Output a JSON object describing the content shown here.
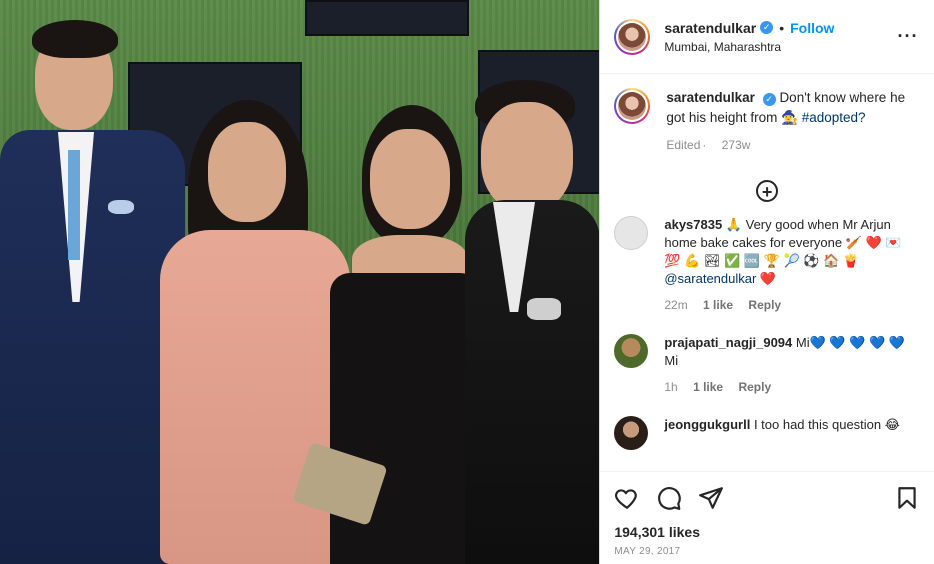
{
  "post": {
    "username": "saratendulkar",
    "follow_label": "Follow",
    "location": "Mumbai, Maharashtra",
    "caption": {
      "text": "Don't know where he got his height from 🧙‍♀️",
      "hashtag": "#adopted?"
    },
    "edited": "Edited",
    "age": "273w",
    "likes": "194,301 likes",
    "date": "MAY 29, 2017"
  },
  "comments": [
    {
      "username": "akys7835",
      "text": "🙏 Very good when Mr Arjun home bake cakes for everyone 🏏 ❤️ 💌 💯 💪 🏞 ✅ 🆒 🏆 🎾 ⚽ 🏠 🍟",
      "mention": "@saratendulkar ❤️",
      "time": "22m",
      "likes": "1 like",
      "reply": "Reply",
      "avatar_color": "#d9d9d9"
    },
    {
      "username": "prajapati_nagji_9094",
      "text": "Mi💙 💙 💙 💙 💙 Mi",
      "time": "1h",
      "likes": "1 like",
      "reply": "Reply",
      "avatar_color": "#6a7a3a"
    },
    {
      "username": "jeonggukgurll",
      "text": "I too had this question 😂",
      "avatar_color": "#3a2a22"
    }
  ],
  "icons": {
    "like": "heart-icon",
    "comment": "comment-icon",
    "share": "share-icon",
    "save": "bookmark-icon",
    "more": "more-options-icon",
    "load_more": "plus-circle-icon",
    "verified": "verified-badge-icon"
  },
  "colors": {
    "link": "#0095f6",
    "verified": "#3897f0",
    "muted": "#8e8e8e",
    "text": "#262626"
  }
}
